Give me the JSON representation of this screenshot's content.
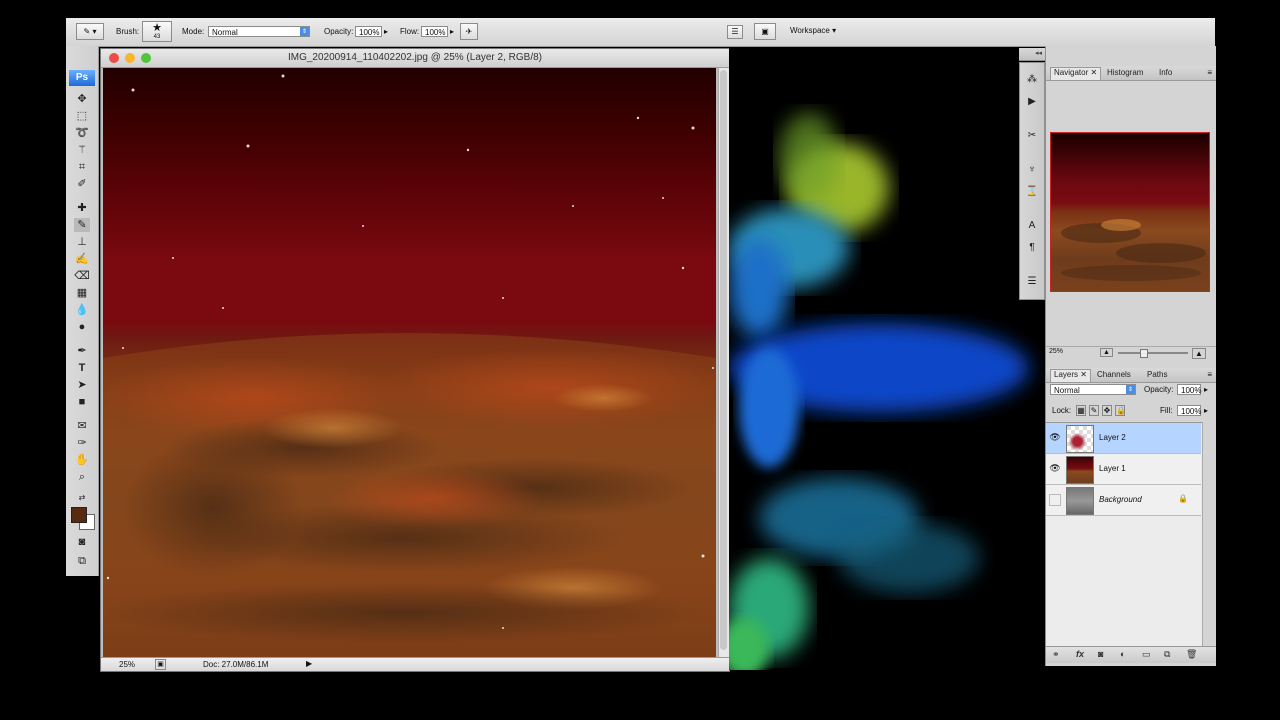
{
  "options_bar": {
    "brush_label": "Brush:",
    "brush_size": "43",
    "mode_label": "Mode:",
    "mode_value": "Normal",
    "opacity_label": "Opacity:",
    "opacity_value": "100%",
    "flow_label": "Flow:",
    "flow_value": "100%",
    "workspace_label": "Workspace"
  },
  "toolbox": {
    "logo": "Ps"
  },
  "document": {
    "title": "IMG_20200914_110402202.jpg @ 25% (Layer 2, RGB/8)",
    "zoom": "25%",
    "doc_info": "Doc: 27.0M/86.1M"
  },
  "navigator": {
    "tabs": [
      "Navigator",
      "Histogram",
      "Info"
    ],
    "zoom": "25%"
  },
  "layers_panel": {
    "tabs": [
      "Layers",
      "Channels",
      "Paths"
    ],
    "blend_mode": "Normal",
    "opacity_label": "Opacity:",
    "opacity_value": "100%",
    "lock_label": "Lock:",
    "fill_label": "Fill:",
    "fill_value": "100%",
    "layers": [
      {
        "name": "Layer 2",
        "visible": true,
        "selected": true
      },
      {
        "name": "Layer 1",
        "visible": true,
        "selected": false
      },
      {
        "name": "Background",
        "visible": false,
        "selected": false
      }
    ],
    "bottom_icons": [
      "link-icon",
      "fx-icon",
      "mask-icon",
      "adjustment-icon",
      "group-icon",
      "new-layer-icon",
      "trash-icon"
    ]
  },
  "colors": {
    "foreground": "#5a2a10",
    "background": "#ffffff",
    "selection": "#b5d4ff",
    "accent": "#4a8fe6"
  }
}
